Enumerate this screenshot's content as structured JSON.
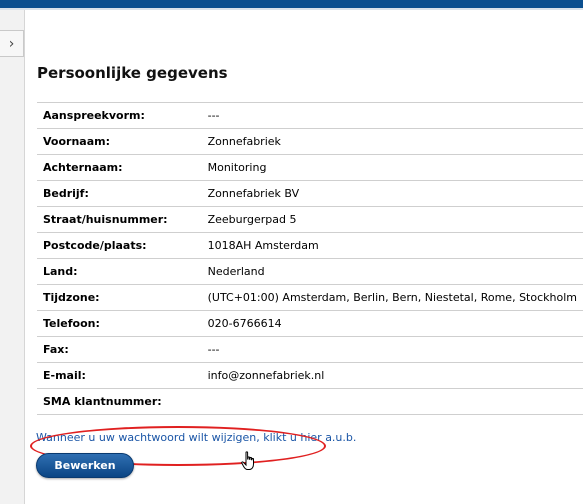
{
  "sidebar": {
    "toggle_icon": "chevron-right-icon",
    "toggle_glyph": "›"
  },
  "page": {
    "title": "Persoonlijke gegevens"
  },
  "details": [
    {
      "label": "Aanspreekvorm:",
      "value": "---"
    },
    {
      "label": "Voornaam:",
      "value": "Zonnefabriek"
    },
    {
      "label": "Achternaam:",
      "value": "Monitoring"
    },
    {
      "label": "Bedrijf:",
      "value": "Zonnefabriek BV"
    },
    {
      "label": "Straat/huisnummer:",
      "value": "Zeeburgerpad 5"
    },
    {
      "label": "Postcode/plaats:",
      "value": "1018AH Amsterdam"
    },
    {
      "label": "Land:",
      "value": "Nederland"
    },
    {
      "label": "Tijdzone:",
      "value": "(UTC+01:00) Amsterdam, Berlin, Bern, Niestetal, Rome, Stockholm"
    },
    {
      "label": "Telefoon:",
      "value": "020-6766614"
    },
    {
      "label": "Fax:",
      "value": "---"
    },
    {
      "label": "E-mail:",
      "value": "info@zonnefabriek.nl"
    },
    {
      "label": "SMA klantnummer:",
      "value": ""
    }
  ],
  "change_password_link": "Wanneer u uw wachtwoord wilt wijzigen, klikt u hier a.u.b.",
  "edit_button": "Bewerken",
  "colors": {
    "header": "#0b4f8f",
    "link": "#1a55a6",
    "highlight": "#e02020",
    "button": "#0b4584"
  }
}
